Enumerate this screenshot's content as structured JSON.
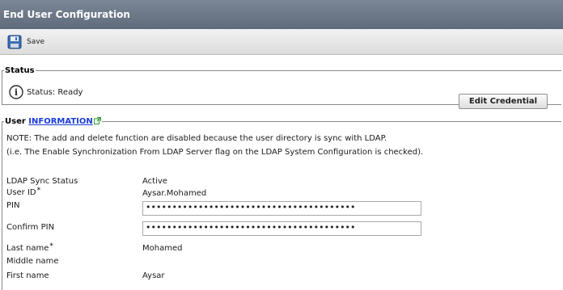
{
  "window": {
    "title": "End User Configuration"
  },
  "toolbar": {
    "save_label": "Save",
    "save_icon": "floppy-disk-icon"
  },
  "status": {
    "legend": "Status",
    "text": "Status: Ready",
    "icon": "info-icon"
  },
  "user": {
    "legend_prefix": "User",
    "legend_link": "INFORMATION",
    "note_line1": "NOTE: The add and delete function are disabled because the user directory is sync with LDAP.",
    "note_line2": "(i.e. The Enable Synchronization From LDAP Server flag on the LDAP System Configuration is checked).",
    "fields": {
      "ldap_sync_status": {
        "label": "LDAP Sync Status",
        "value": "Active"
      },
      "user_id": {
        "label": "User ID",
        "required": "*",
        "value": "Aysar.Mohamed"
      },
      "pin": {
        "label": "PIN",
        "value": "••••••••••••••••••••••••••••••••••••••••"
      },
      "confirm_pin": {
        "label": "Confirm PIN",
        "value": "••••••••••••••••••••••••••••••••••••••••"
      },
      "last_name": {
        "label": "Last name",
        "required": "*",
        "value": "Mohamed"
      },
      "middle_name": {
        "label": "Middle name",
        "value": ""
      },
      "first_name": {
        "label": "First name",
        "value": "Aysar"
      }
    },
    "edit_credential_label": "Edit Credential"
  },
  "colors": {
    "title_bar": "#66717f",
    "link": "#1a3bd6",
    "info_icon": "#2b2b2b"
  }
}
